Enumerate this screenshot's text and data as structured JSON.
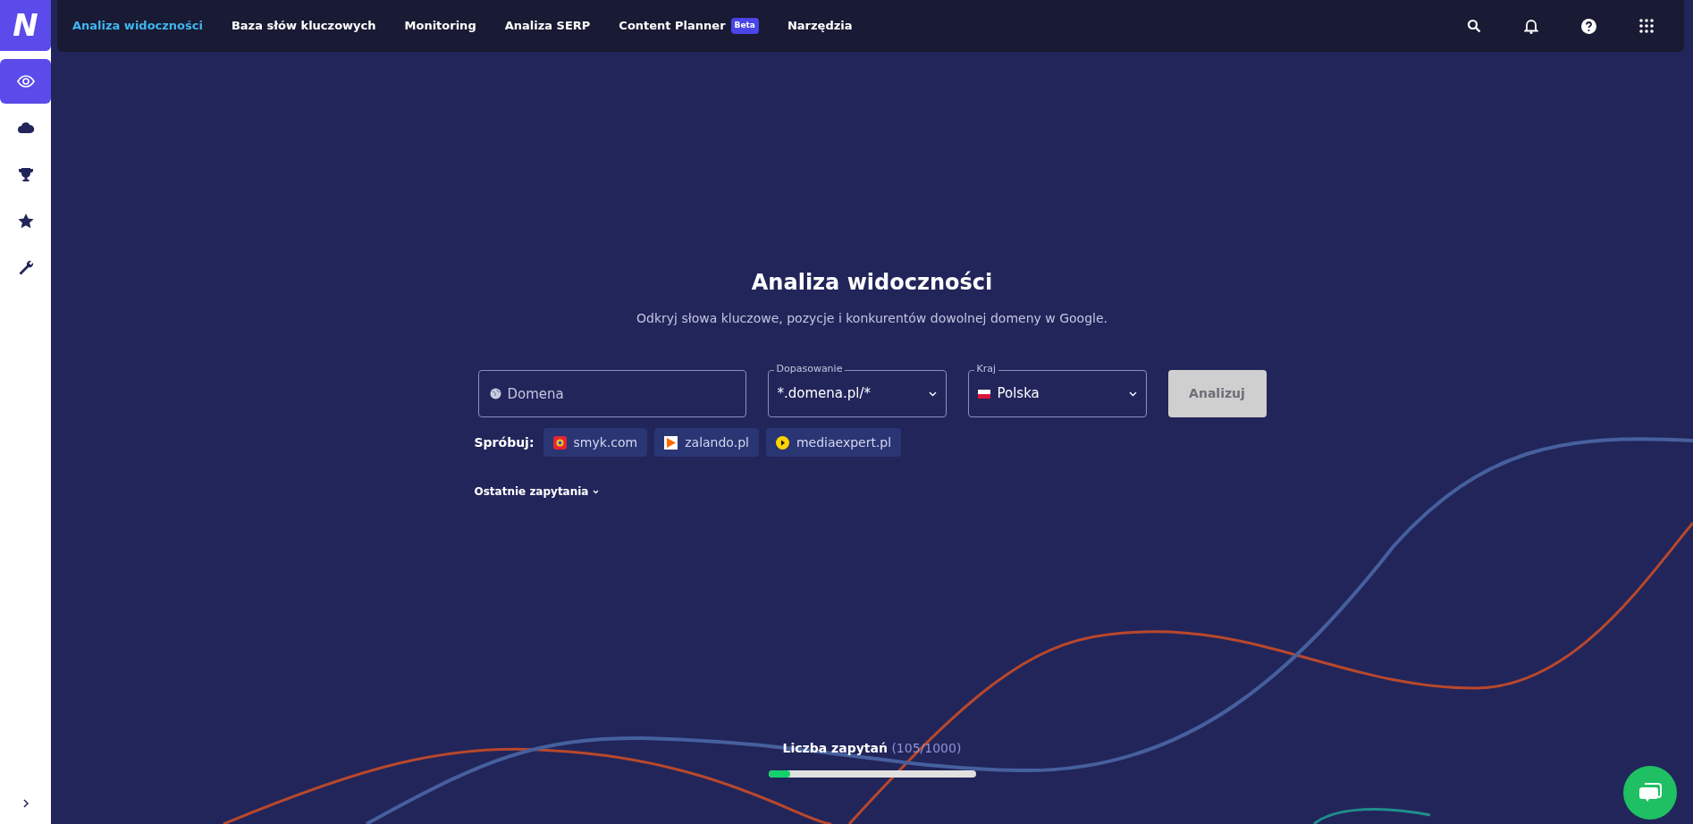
{
  "logo": {
    "letter": "N"
  },
  "sidebar": {
    "items": [
      {
        "kind": "eye",
        "selected": true
      },
      {
        "kind": "cloud",
        "selected": false
      },
      {
        "kind": "trophy",
        "selected": false
      },
      {
        "kind": "star",
        "selected": false
      },
      {
        "kind": "wrench",
        "selected": false
      }
    ]
  },
  "nav": {
    "items": [
      {
        "label": "Analiza widoczności",
        "selected": true
      },
      {
        "label": "Baza słów kluczowych",
        "selected": false
      },
      {
        "label": "Monitoring",
        "selected": false
      },
      {
        "label": "Analiza SERP",
        "selected": false
      },
      {
        "label": "Content Planner",
        "selected": false,
        "badge": "Beta"
      },
      {
        "label": "Narzędzia",
        "selected": false
      }
    ]
  },
  "title": "Analiza widoczności",
  "subtitle": "Odkryj słowa kluczowe, pozycje i konkurentów dowolnej domeny w Google.",
  "domain_field": {
    "placeholder": "Domena"
  },
  "match_select": {
    "label": "Dopasowanie",
    "value": "*.domena.pl/*"
  },
  "country_select": {
    "label": "Kraj",
    "value": "Polska"
  },
  "analyze_button": {
    "label": "Analizuj",
    "disabled": true
  },
  "try": {
    "label": "Spróbuj:",
    "items": [
      {
        "kind": "smyk",
        "label": "smyk.com"
      },
      {
        "kind": "zalando",
        "label": "zalando.pl"
      },
      {
        "kind": "mediaexpert",
        "label": "mediaexpert.pl"
      }
    ]
  },
  "recent": {
    "label": "Ostatnie zapytania",
    "expanded": false
  },
  "quota": {
    "label": "Liczba zapytań",
    "count": "(105/1000)",
    "level": 0.105
  }
}
